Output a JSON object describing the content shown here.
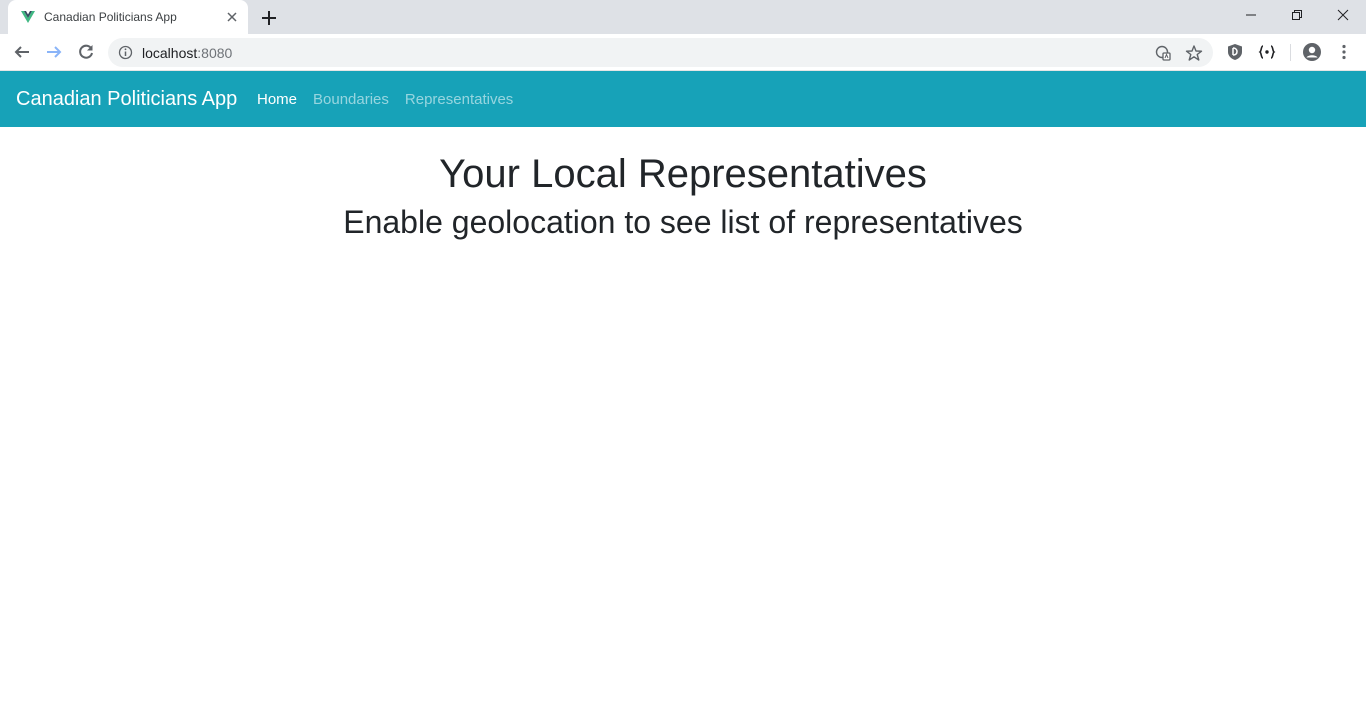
{
  "browser": {
    "tab": {
      "title": "Canadian Politicians App"
    },
    "address_bar": {
      "host": "localhost",
      "port": ":8080"
    }
  },
  "navbar": {
    "brand": "Canadian Politicians App",
    "links": [
      {
        "label": "Home",
        "active": true
      },
      {
        "label": "Boundaries",
        "active": false
      },
      {
        "label": "Representatives",
        "active": false
      }
    ],
    "background_color": "#17a2b8"
  },
  "main": {
    "title": "Your Local Representatives",
    "subtitle": "Enable geolocation to see list of representatives"
  },
  "icons": [
    "vue-favicon-icon",
    "tab-close-icon",
    "new-tab-icon",
    "minimize-icon",
    "maximize-icon",
    "window-close-icon",
    "back-arrow-icon",
    "forward-arrow-icon",
    "reload-icon",
    "info-icon",
    "translate-icon",
    "star-icon",
    "shield-extension-icon",
    "json-extension-icon",
    "profile-icon",
    "kebab-menu-icon"
  ]
}
